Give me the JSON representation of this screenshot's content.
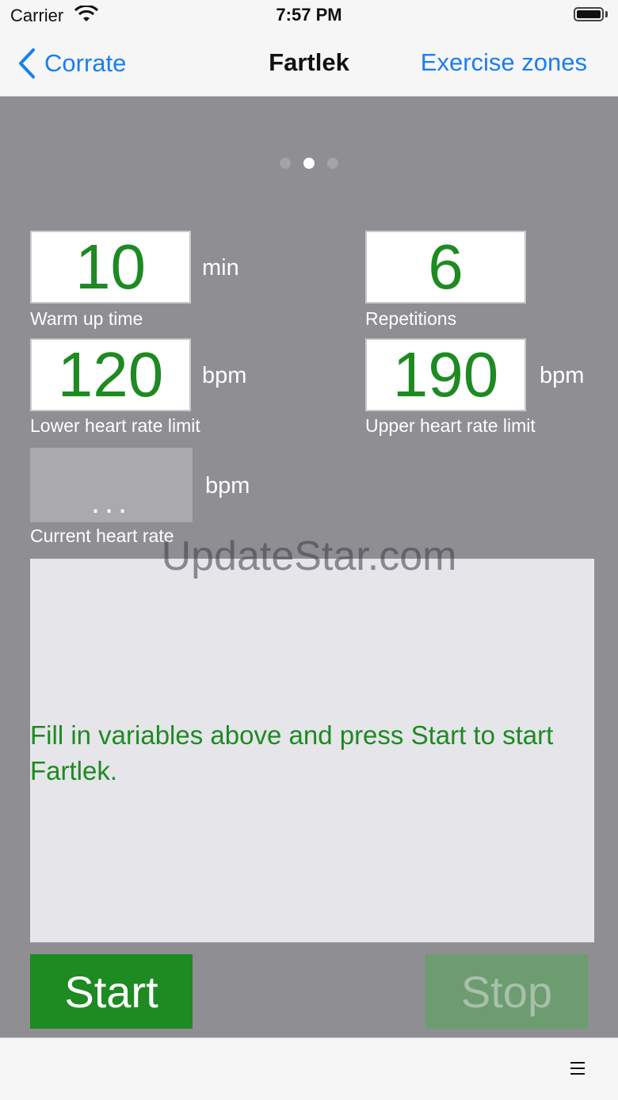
{
  "status": {
    "carrier": "Carrier",
    "time": "7:57 PM"
  },
  "nav": {
    "back_label": "Corrate",
    "title": "Fartlek",
    "right_label": "Exercise zones"
  },
  "pager": {
    "count": 3,
    "active_index": 1
  },
  "fields": {
    "warmup": {
      "value": "10",
      "unit": "min",
      "label": "Warm up time"
    },
    "repetitions": {
      "value": "6",
      "label": "Repetitions"
    },
    "lower_hr": {
      "value": "120",
      "unit": "bpm",
      "label": "Lower heart rate limit"
    },
    "upper_hr": {
      "value": "190",
      "unit": "bpm",
      "label": "Upper heart rate limit"
    },
    "current_hr": {
      "value": "...",
      "unit": "bpm",
      "label": "Current heart rate"
    }
  },
  "watermark": "UpdateStar.com",
  "message": "Fill in variables above and press Start to start Fartlek.",
  "buttons": {
    "start": "Start",
    "stop": "Stop"
  },
  "colors": {
    "accent_blue": "#1a7ef0",
    "value_green": "#1e8a22",
    "background_gray": "#8e8e93",
    "stop_disabled": "#6c9c70"
  },
  "icons": {
    "back": "chevron-left-icon",
    "menu": "hamburger-menu-icon",
    "wifi": "wifi-icon",
    "battery": "battery-icon"
  }
}
